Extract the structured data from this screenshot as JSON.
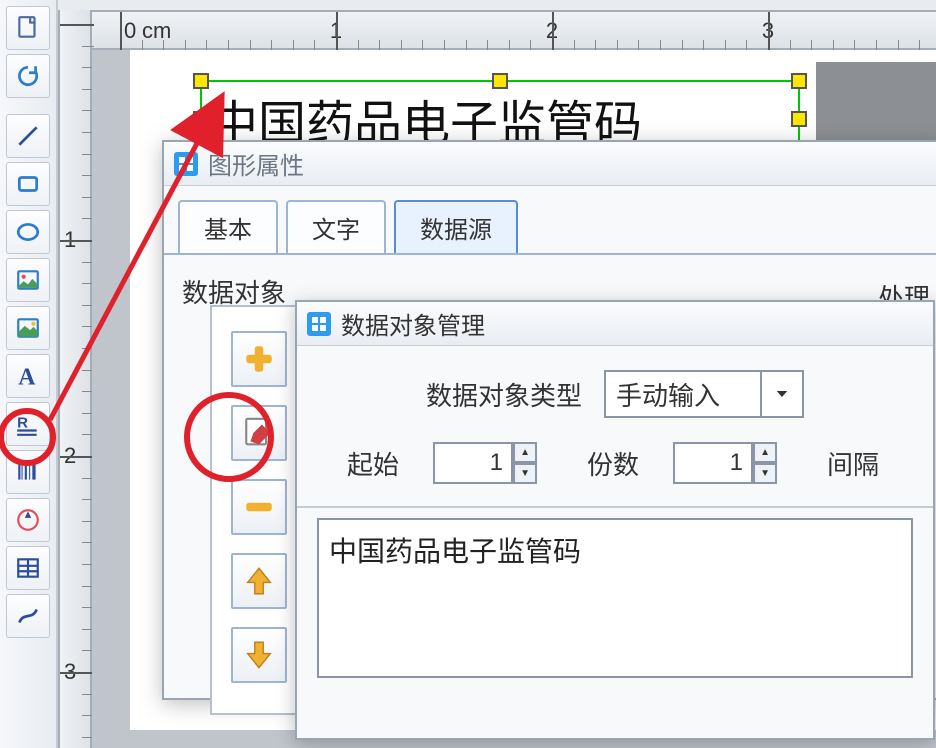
{
  "ruler": {
    "unit": "cm",
    "h_ticks": [
      0,
      1,
      2,
      3
    ],
    "v_ticks": [
      1,
      2,
      3
    ]
  },
  "canvas_text": "中国药品电子监管码",
  "dialog_props": {
    "title": "图形属性",
    "tabs": {
      "basic": "基本",
      "text": "文字",
      "datasource": "数据源"
    },
    "section_data_obj": "数据对象",
    "section_process": "处理"
  },
  "dialog_inner": {
    "title": "数据对象管理",
    "type_label": "数据对象类型",
    "type_value": "手动输入",
    "start_label": "起始",
    "start_value": "1",
    "count_label": "份数",
    "count_value": "1",
    "interval_label": "间隔",
    "content": "中国药品电子监管码"
  }
}
